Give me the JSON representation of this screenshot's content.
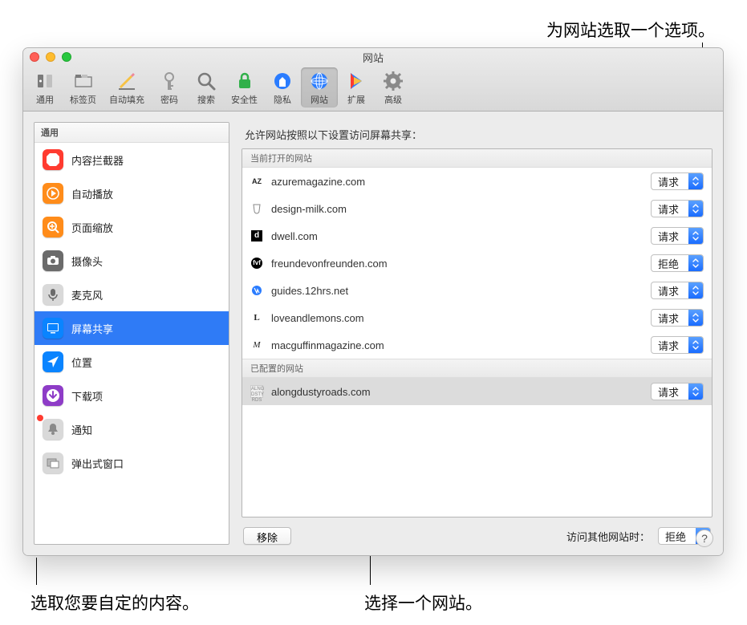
{
  "callouts": {
    "top": "为网站选取一个选项。",
    "bottom_left": "选取您要自定的内容。",
    "bottom_right": "选择一个网站。"
  },
  "window": {
    "title": "网站"
  },
  "toolbar": [
    {
      "id": "general",
      "label": "通用"
    },
    {
      "id": "tabs",
      "label": "标签页"
    },
    {
      "id": "autofill",
      "label": "自动填充"
    },
    {
      "id": "passwords",
      "label": "密码"
    },
    {
      "id": "search",
      "label": "搜索"
    },
    {
      "id": "security",
      "label": "安全性"
    },
    {
      "id": "privacy",
      "label": "隐私"
    },
    {
      "id": "websites",
      "label": "网站",
      "selected": true
    },
    {
      "id": "extensions",
      "label": "扩展"
    },
    {
      "id": "advanced",
      "label": "高级"
    }
  ],
  "sidebar": {
    "header": "通用",
    "items": [
      {
        "id": "content-blockers",
        "label": "内容拦截器",
        "color": "#ff3b30"
      },
      {
        "id": "autoplay",
        "label": "自动播放",
        "color": "#ff8c1a"
      },
      {
        "id": "zoom",
        "label": "页面缩放",
        "color": "#ff8c1a"
      },
      {
        "id": "camera",
        "label": "摄像头",
        "color": "#6b6b6b"
      },
      {
        "id": "microphone",
        "label": "麦克风",
        "color": "#d9d9d9"
      },
      {
        "id": "screenshare",
        "label": "屏幕共享",
        "color": "#0a84ff",
        "selected": true
      },
      {
        "id": "location",
        "label": "位置",
        "color": "#0a84ff"
      },
      {
        "id": "downloads",
        "label": "下载项",
        "color": "#8e3cc7"
      },
      {
        "id": "notifications",
        "label": "通知",
        "color": "#d9d9d9",
        "badge": true
      },
      {
        "id": "popups",
        "label": "弹出式窗口",
        "color": "#d9d9d9"
      }
    ]
  },
  "main": {
    "description": "允许网站按照以下设置访问屏幕共享：",
    "open_header": "当前打开的网站",
    "configured_header": "已配置的网站",
    "open_sites": [
      {
        "name": "azuremagazine.com",
        "option": "请求"
      },
      {
        "name": "design-milk.com",
        "option": "请求"
      },
      {
        "name": "dwell.com",
        "option": "请求"
      },
      {
        "name": "freundevonfreunden.com",
        "option": "拒绝"
      },
      {
        "name": "guides.12hrs.net",
        "option": "请求"
      },
      {
        "name": "loveandlemons.com",
        "option": "请求"
      },
      {
        "name": "macguffinmagazine.com",
        "option": "请求"
      }
    ],
    "configured_sites": [
      {
        "name": "alongdustyroads.com",
        "option": "请求"
      }
    ],
    "remove_label": "移除",
    "other_label": "访问其他网站时：",
    "other_value": "拒绝"
  }
}
